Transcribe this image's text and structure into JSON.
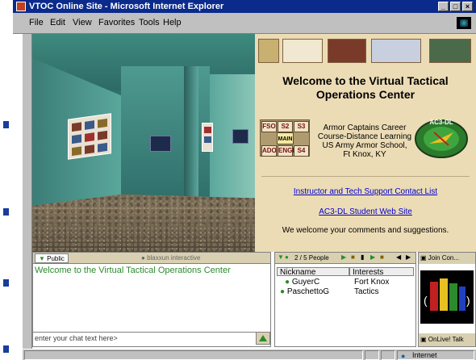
{
  "window": {
    "title": "VTOC Online Site - Microsoft Internet Explorer",
    "controls": [
      "_",
      "□",
      "×"
    ]
  },
  "menu": [
    {
      "label": "File",
      "accel": "F"
    },
    {
      "label": "Edit",
      "accel": "E"
    },
    {
      "label": "View",
      "accel": "V"
    },
    {
      "label": "Favorites",
      "accel": "a"
    },
    {
      "label": "Tools",
      "accel": "T"
    },
    {
      "label": "Help",
      "accel": "H"
    }
  ],
  "web": {
    "welcome_line1": "Welcome to the Virtual Tactical",
    "welcome_line2": "Operations Center",
    "staff": {
      "fso": "FSO",
      "s2": "S2",
      "s3": "S3",
      "main": "MAIN",
      "ado": "ADO",
      "engr": "ENGR",
      "s4": "S4"
    },
    "org_line1": "Armor Captains Career",
    "org_line2": "Course-Distance Learning",
    "org_line3": "US Army Armor School,",
    "org_line4": "Ft Knox, KY",
    "emblem_text": "AC3-DL",
    "link_support": "Instructor and Tech Support Contact List",
    "link_student": "AC3-DL Student Web Site",
    "note": "We welcome your comments and suggestions."
  },
  "chat": {
    "tab_public": "Public",
    "tab_brand": "blaxxun interactive",
    "log_line": "Welcome to the Virtual Tactical Operations Center",
    "input_placeholder": "enter your chat text here>"
  },
  "people": {
    "count_label": "2 / 5 People",
    "col_nickname": "Nickname",
    "col_interests": "Interests",
    "rows": [
      {
        "nickname": "GuyerC",
        "interests": "Fort Knox"
      },
      {
        "nickname": "PaschettoG",
        "interests": "Tactics"
      }
    ]
  },
  "ad": {
    "top_label": "Join Con...",
    "bottom_label": "OnLive! Talk"
  },
  "status": {
    "zone": "Internet"
  },
  "colors": {
    "titlebar": "#0a2a8c",
    "web_bg": "#ecdcb6",
    "chat_text": "#2c8a2c",
    "link": "#0000cc"
  }
}
